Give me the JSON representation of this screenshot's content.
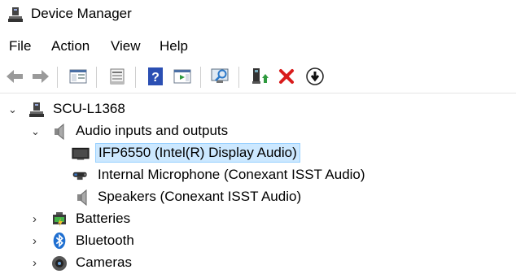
{
  "window": {
    "title": "Device Manager"
  },
  "menu": [
    "File",
    "Action",
    "View",
    "Help"
  ],
  "toolbar": {
    "buttons": [
      {
        "name": "back-arrow-icon"
      },
      {
        "name": "forward-arrow-icon"
      },
      {
        "name": "show-hide-console-tree-icon"
      },
      {
        "name": "properties-icon"
      },
      {
        "name": "help-icon"
      },
      {
        "name": "show-action-pane-icon"
      },
      {
        "name": "scan-hardware-changes-icon"
      },
      {
        "name": "update-driver-icon"
      },
      {
        "name": "uninstall-device-icon"
      },
      {
        "name": "disable-device-icon"
      }
    ],
    "colors": {
      "delete_red": "#d91c1c",
      "help_blue": "#2b4fb3",
      "update_green": "#2e9a3e"
    }
  },
  "tree": {
    "root": "SCU-L1368",
    "nodes": [
      {
        "label": "Audio inputs and outputs",
        "expanded": true,
        "icon": "speaker-icon"
      },
      {
        "label": "IFP6550 (Intel(R) Display Audio)",
        "child": true,
        "selected": true,
        "icon": "monitor-icon"
      },
      {
        "label": "Internal Microphone (Conexant ISST Audio)",
        "child": true,
        "icon": "microphone-icon"
      },
      {
        "label": "Speakers (Conexant ISST Audio)",
        "child": true,
        "icon": "speaker-icon"
      },
      {
        "label": "Batteries",
        "expanded": false,
        "icon": "battery-icon"
      },
      {
        "label": "Bluetooth",
        "expanded": false,
        "icon": "bluetooth-icon"
      },
      {
        "label": "Cameras",
        "expanded": false,
        "icon": "camera-icon"
      }
    ],
    "selection_color": "#cce8ff"
  }
}
